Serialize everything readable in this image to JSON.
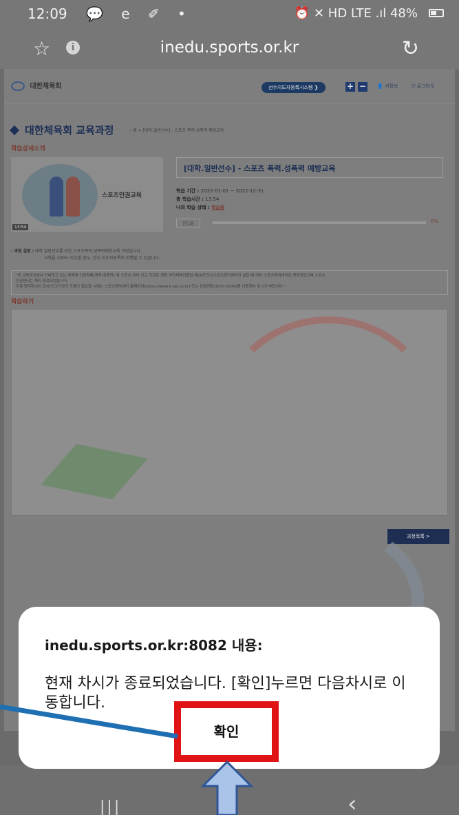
{
  "status_bar": {
    "time": "12:09",
    "left_icons": "💬 e ✐ •",
    "right_icons": "⏰ ✕ HD LTE .ıl 48%"
  },
  "browser": {
    "url": "inedu.sports.or.kr"
  },
  "page": {
    "logo_text": "대한체육회",
    "system_button": "선수지도자등록시스템 ❯",
    "plus": "+",
    "minus": "−",
    "mypage": "서정보",
    "logout": "로그아웃",
    "course_title": "대한체육회 교육과정",
    "breadcrumb": "› 홈 > [대학.일반선수] - 스포츠 폭력.성폭력 예방교육",
    "detail_label": "학습상세소개",
    "thumb_title": "스포츠인권교육",
    "thumb_duration": "13:54",
    "course_name": "[대학.일반선수] - 스포츠 폭력.성폭력 예방교육",
    "period_label": "학습 기간 :",
    "period_value": "2022-01-01 ~ 2022-12-31",
    "total_time_label": "총 학습시간 :",
    "total_time_value": "13:54",
    "status_label": "나의 학습 상태 :",
    "status_value": "학습중",
    "progress_label": "진도율",
    "progress_pct": "0%",
    "progress": 0,
    "desc_label": "· 과정 설명 :",
    "desc_line1": "대학.일반선수를 위한 스포츠폭력.성폭력예방교육 과정입니다.",
    "desc_line2": "교육을 100% 이수할 경우, 선수.지도자등록이 진행될 수 있습니다.",
    "notice_line1": "\"동 교육영상에서 안내하고 있는 체육계 인권침해(폭력/성폭력) 및 스포츠 비리 신고 기관은 개정 국민체육진흥법 제18조의3(스포츠윤리센터의 설립)에 따라 스포츠윤리센터로 변경되었으며 스포츠",
    "notice_line2": "인권센터는 폐지 종료되었습니다.",
    "notice_line3": "이점 양지하시어 조사/신고기관의 도움이 필요할 시에는 스포츠윤리센터 홈페이지(https://www.k-sec.or.kr) 또는 상담전화(1670-2876)를 이용하여 주시기 바랍니다.\"",
    "learn_label": "학습하기",
    "list_button": "과정목록 >"
  },
  "dialog": {
    "title": "inedu.sports.or.kr:8082 내용:",
    "message": "현재 차시가 종료되었습니다. [확인]누르면 다음차시로 이동합니다.",
    "ok_button": "확인"
  },
  "colors": {
    "highlight": "#e01414",
    "pointer": "#1f6fb3",
    "arrow_fill": "#a9c4e8",
    "arrow_stroke": "#2f5597"
  }
}
